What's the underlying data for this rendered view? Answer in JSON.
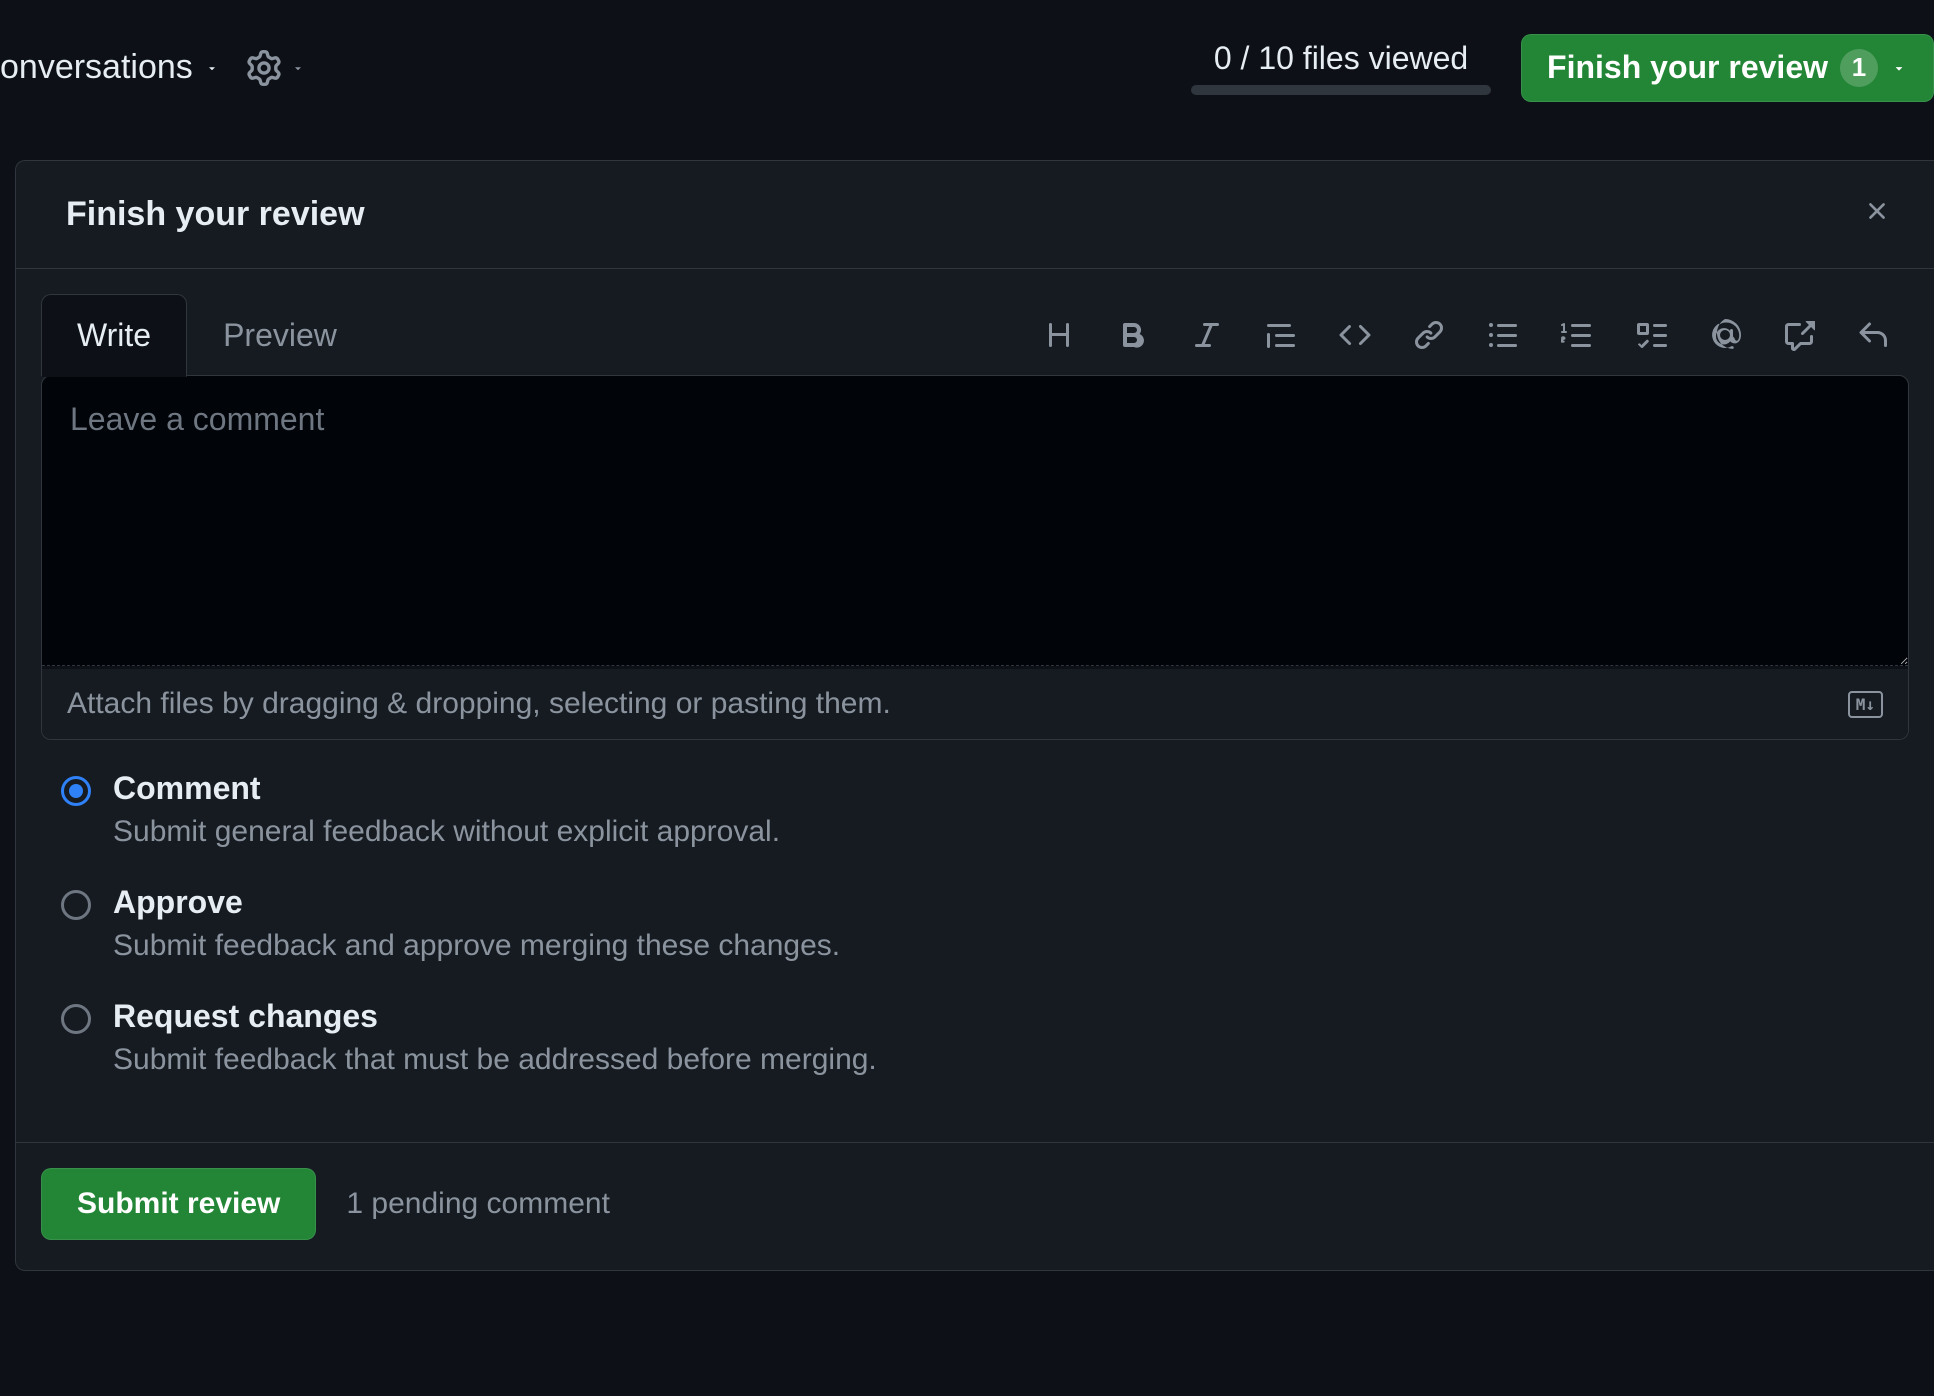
{
  "topbar": {
    "conversations_label": "onversations",
    "files_viewed": "0 / 10 files viewed",
    "finish_review_label": "Finish your review",
    "review_count": "1"
  },
  "dialog": {
    "title": "Finish your review",
    "tabs": {
      "write": "Write",
      "preview": "Preview"
    },
    "textarea_placeholder": "Leave a comment",
    "attach_hint": "Attach files by dragging & dropping, selecting or pasting them.",
    "options": {
      "comment": {
        "title": "Comment",
        "desc": "Submit general feedback without explicit approval."
      },
      "approve": {
        "title": "Approve",
        "desc": "Submit feedback and approve merging these changes."
      },
      "request_changes": {
        "title": "Request changes",
        "desc": "Submit feedback that must be addressed before merging."
      }
    },
    "submit_label": "Submit review",
    "pending_label": "1 pending comment"
  }
}
